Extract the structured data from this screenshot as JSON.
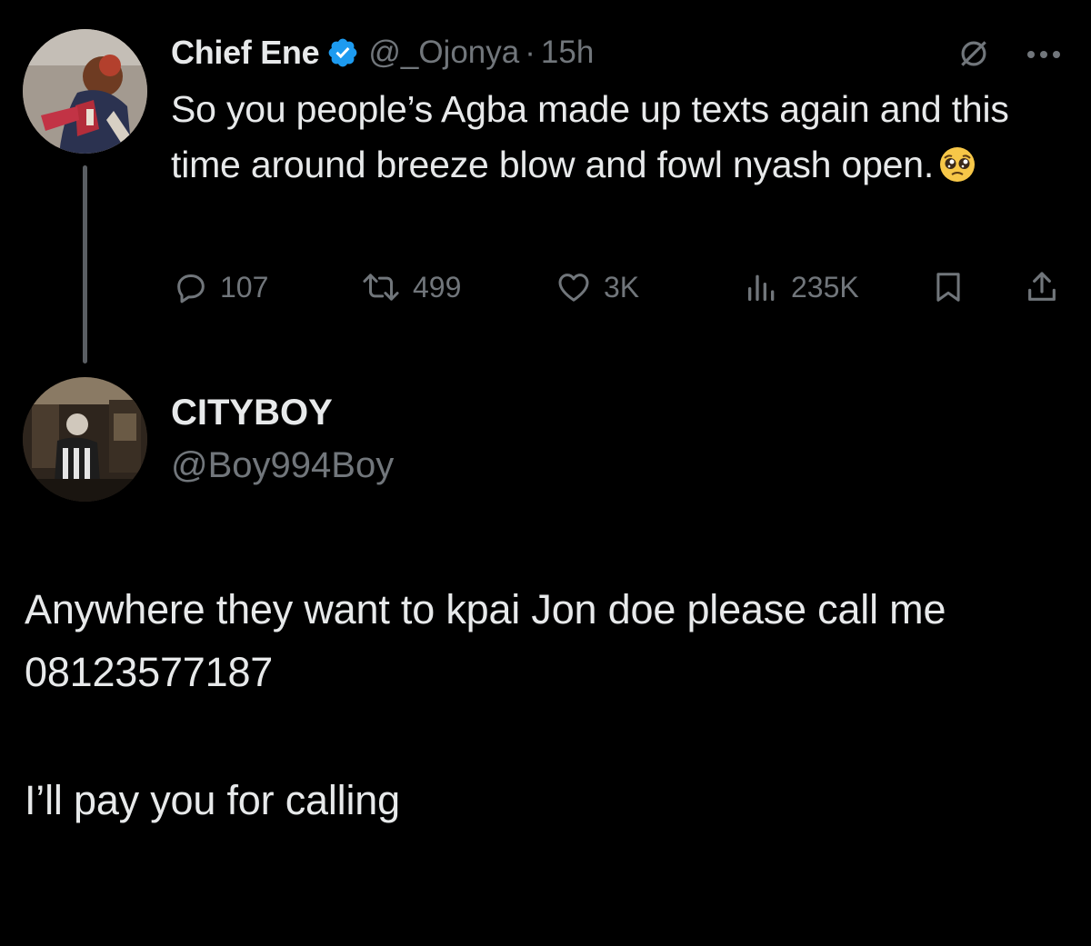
{
  "parent_tweet": {
    "display_name": "Chief Ene",
    "verified": true,
    "handle": "@_Ojonya",
    "separator": "·",
    "time": "15h",
    "text": "So you people’s Agba made up texts again and this time around breeze blow and fowl nyash open.",
    "emoji": "pleading-face",
    "replies": "107",
    "reposts": "499",
    "likes": "3K",
    "views": "235K",
    "avatar_icon": "user-avatar-photo"
  },
  "reply_tweet": {
    "display_name": "CITYBOY",
    "handle": "@Boy994Boy",
    "avatar_icon": "user-avatar-photo",
    "lines": [
      "Anywhere they want to kpai Jon doe please call me",
      "08123577187",
      "I’ll pay you for calling"
    ]
  },
  "colors": {
    "background": "#000000",
    "primary_text": "#e7e9ea",
    "secondary_text": "#71767b",
    "verified_badge": "#1d9bf0",
    "thread_line": "#5a5e63"
  }
}
